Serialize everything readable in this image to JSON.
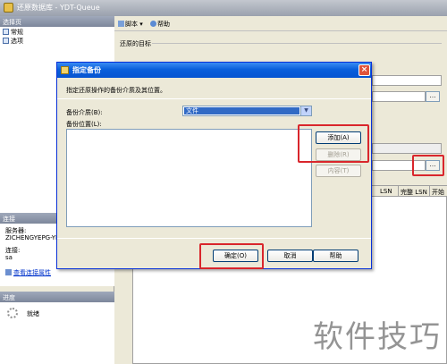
{
  "window": {
    "title": "还原数据库 - YDT-Queue"
  },
  "left_pane": {
    "pages_header": "选择页",
    "pages": [
      {
        "label": "常规"
      },
      {
        "label": "选项"
      }
    ],
    "connection_header": "连接",
    "connection": {
      "server_label": "服务器:",
      "server_value": "ZICHENGYEPG-YDT",
      "conn_label": "连接:",
      "conn_value": "sa",
      "view_link": "查看连接属性"
    },
    "progress_header": "进度",
    "progress_status": "就绪"
  },
  "toolbar": {
    "script_label": "脚本",
    "help_label": "帮助"
  },
  "main": {
    "restore_target_title": "还原的目标",
    "grid_columns": [
      "LSN",
      "完整 LSN",
      "开始"
    ]
  },
  "dialog": {
    "title": "指定备份",
    "instruction": "指定还原操作的备份介质及其位置。",
    "media_label": "备份介质(B):",
    "media_value": "文件",
    "location_label": "备份位置(L):",
    "add_label": "添加(A)",
    "delete_label": "删除(R)",
    "contents_label": "内容(T)",
    "ok_label": "确定(O)",
    "cancel_label": "取消",
    "help_label": "帮助",
    "close_label": "×"
  },
  "watermark": "软件技巧",
  "colors": {
    "highlight": "#d9262c",
    "dialog_title": "#0a5fdb",
    "selection": "#316ac5"
  }
}
